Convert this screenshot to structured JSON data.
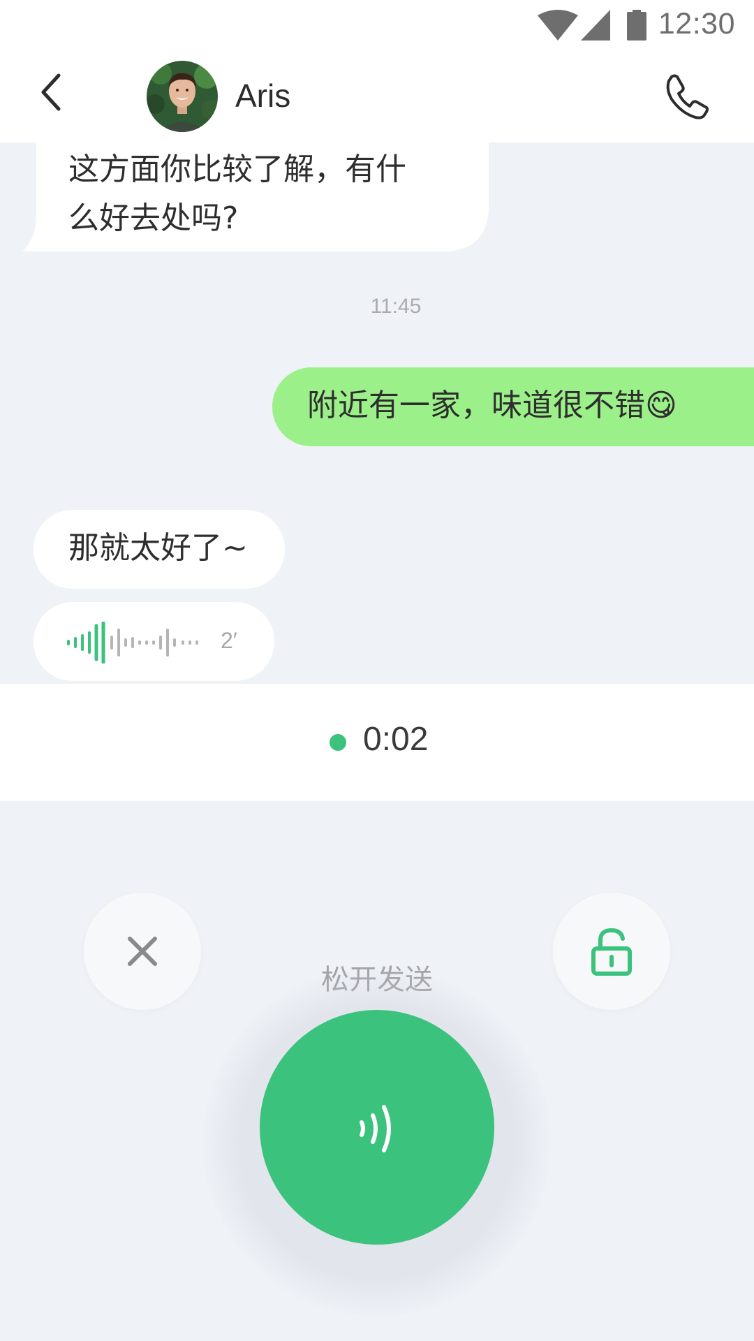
{
  "status_bar": {
    "time": "12:30",
    "icons": [
      "wifi-icon",
      "cellular-signal-icon",
      "battery-icon"
    ]
  },
  "header": {
    "contact_name": "Aris",
    "back_icon": "chevron-left-icon",
    "call_icon": "phone-icon",
    "avatar_icon": "contact-avatar"
  },
  "messages": [
    {
      "from": "contact",
      "text_line_1": "这方面你比较了解，有什",
      "text_line_2": "么好去处吗?"
    },
    {
      "from": "me",
      "text": "附近有一家，味道很不错😋"
    },
    {
      "from": "contact",
      "text": "那就太好了~"
    },
    {
      "from": "contact",
      "type": "voice",
      "duration": "2′"
    }
  ],
  "time_separator": "11:45",
  "recording": {
    "elapsed": "0:02",
    "hint": "松开发送"
  },
  "controls": {
    "cancel_icon": "close-icon",
    "lock_icon": "unlock-icon",
    "mic_icon": "voice-waves-icon"
  },
  "colors": {
    "accent": "#3bc27d",
    "my_bubble": "#9cf08a",
    "background": "#eff2f7"
  }
}
